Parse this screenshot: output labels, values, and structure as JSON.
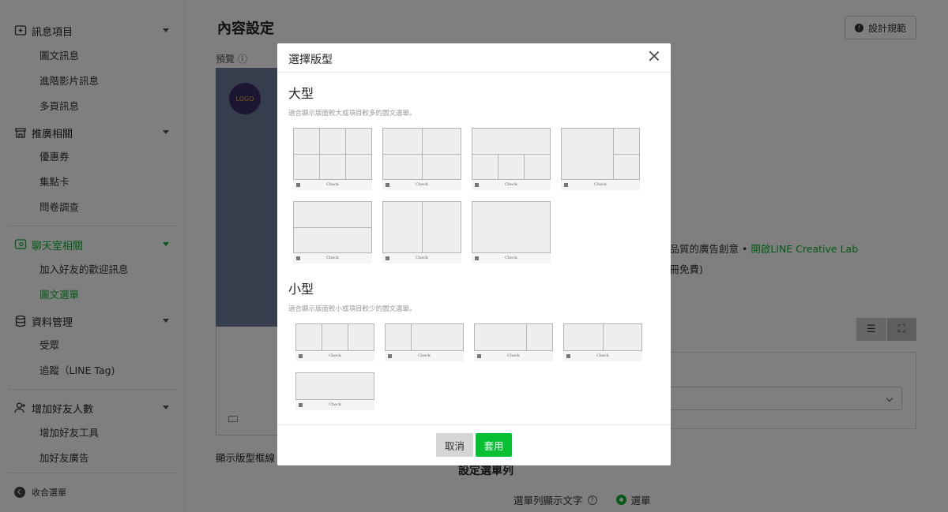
{
  "sidebar": {
    "groups": [
      {
        "label": "訊息項目",
        "items": [
          "圖文訊息",
          "進階影片訊息",
          "多頁訊息"
        ]
      },
      {
        "label": "推廣相關",
        "items": [
          "優惠券",
          "集點卡",
          "問卷調查"
        ]
      },
      {
        "label": "聊天室相關",
        "items": [
          "加入好友的歡迎訊息",
          "圖文選單"
        ]
      },
      {
        "label": "資料管理",
        "items": [
          "受眾",
          "追蹤（LINE Tag)"
        ]
      },
      {
        "label": "增加好友人數",
        "items": [
          "增加好友工具",
          "加好友廣告"
        ]
      }
    ],
    "collapse_label": "收合選單",
    "active_color": "#06b32a"
  },
  "main": {
    "page_title": "內容設定",
    "guide_button": "設計規範",
    "preview_label": "預覽",
    "frame_label": "顯示版型框線",
    "promo_text": "高品質的廣告創意",
    "promo_link": "開啟LINE Creative Lab",
    "promo_text2": "註冊免費)",
    "menubar_title": "設定選單列",
    "menubar_text_label": "選單列顯示文字",
    "menubar_radio": "選單",
    "preview_avatar_text": "LOGO"
  },
  "modal": {
    "title": "選擇版型",
    "large": {
      "title": "大型",
      "desc": "適合顯示版面較大或項目較多的圖文選單。"
    },
    "small": {
      "title": "小型",
      "desc": "適合顯示版面較小或項目較少的圖文選單。"
    },
    "template_bar_text": "Check",
    "cancel": "取消",
    "apply": "套用",
    "apply_color": "#06c032"
  }
}
